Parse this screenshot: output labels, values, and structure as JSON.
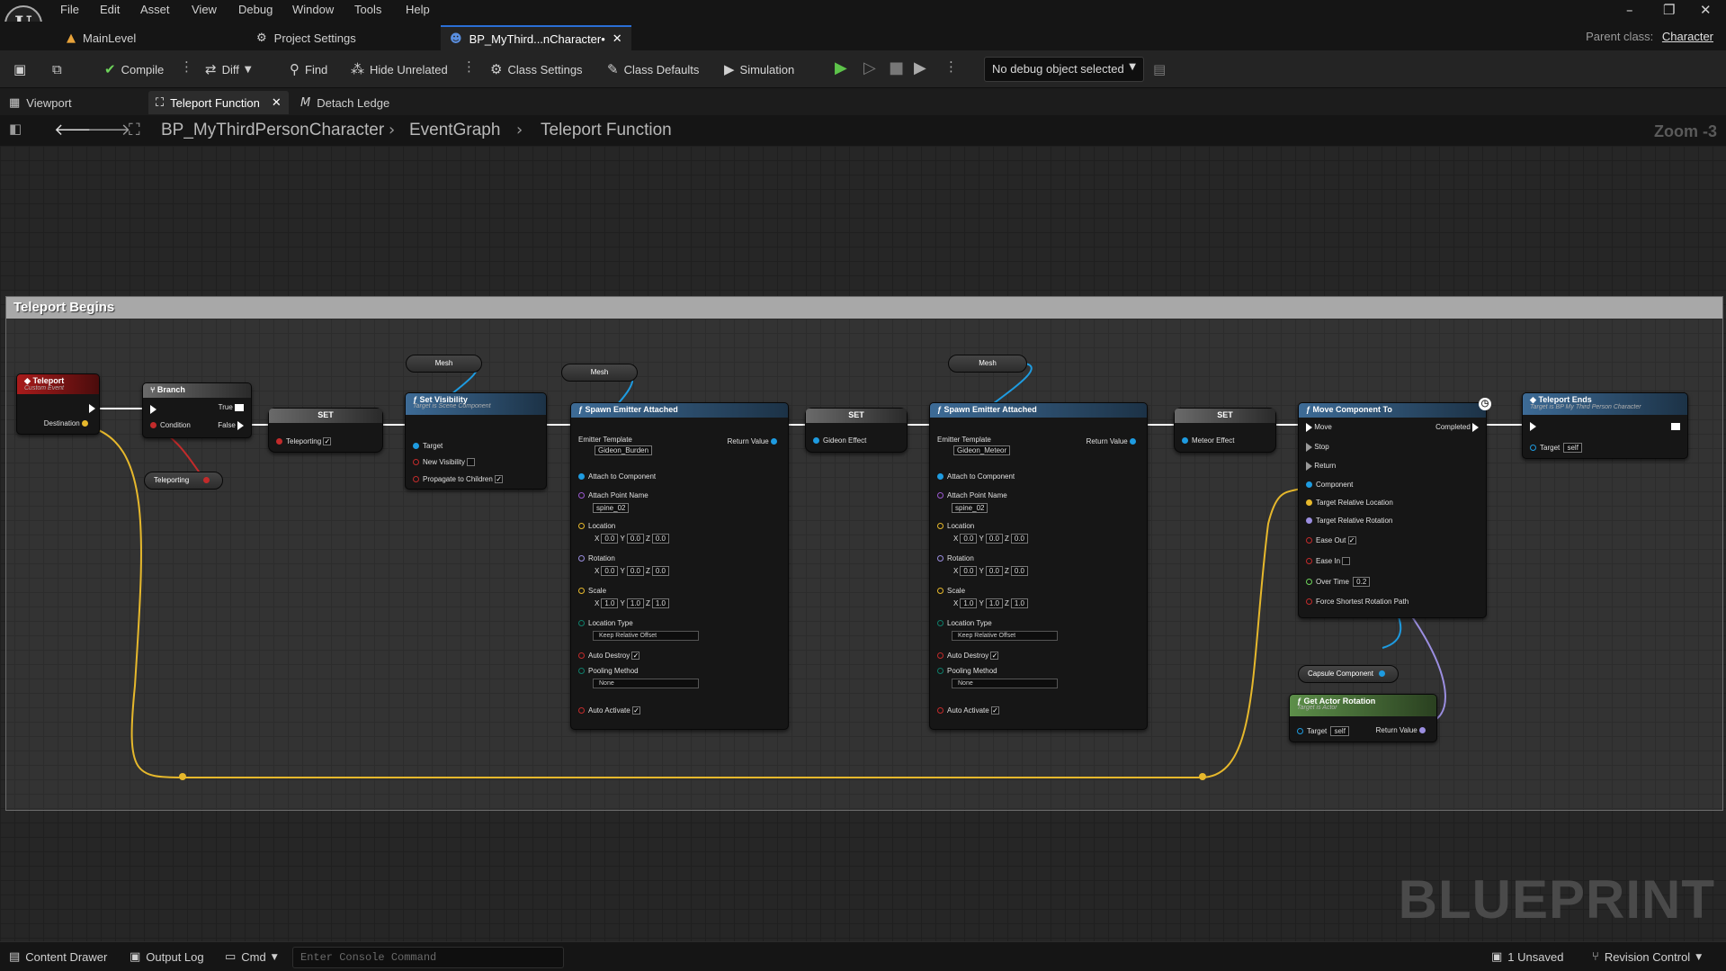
{
  "menu": [
    "File",
    "Edit",
    "Asset",
    "View",
    "Debug",
    "Window",
    "Tools",
    "Help"
  ],
  "logo": "U",
  "doc_tabs": [
    {
      "label": "MainLevel",
      "icon": "level-icon"
    },
    {
      "label": "Project Settings",
      "icon": "settings-icon"
    },
    {
      "label": "BP_MyThird...nCharacter•",
      "icon": "character-icon",
      "active": true
    }
  ],
  "parent_class": {
    "label": "Parent class:",
    "value": "Character"
  },
  "toolbar": {
    "compile": "Compile",
    "diff": "Diff",
    "find": "Find",
    "hide_unrelated": "Hide Unrelated",
    "class_settings": "Class Settings",
    "class_defaults": "Class Defaults",
    "simulation": "Simulation",
    "debug_select": "No debug object selected"
  },
  "editor_tabs": [
    {
      "label": "Viewport"
    },
    {
      "label": "Teleport Function",
      "active": true
    },
    {
      "label": "Detach Ledge"
    }
  ],
  "breadcrumb": [
    "BP_MyThirdPersonCharacter",
    "EventGraph",
    "Teleport Function"
  ],
  "zoom": "Zoom -3",
  "comment_title": "Teleport Begins",
  "watermark": "BLUEPRINT",
  "nodes": {
    "teleport_event": {
      "title": "Teleport",
      "subtitle": "Custom Event",
      "pin": "Destination"
    },
    "branch": {
      "title": "Branch",
      "condition": "Condition",
      "true": "True",
      "false": "False"
    },
    "teleporting_var": "Teleporting",
    "set1": {
      "title": "SET",
      "pin": "Teleporting"
    },
    "mesh_var": "Mesh",
    "set_visibility": {
      "title": "Set Visibility",
      "subtitle": "Target is Scene Component",
      "target": "Target",
      "new_visibility": "New Visibility",
      "propagate": "Propagate to Children"
    },
    "spawn1": {
      "title": "Spawn Emitter Attached",
      "emitter": "Emitter Template",
      "emitter_value": "Gideon_Burden",
      "return": "Return Value",
      "attach": "Attach to Component",
      "attach_point": "Attach Point Name",
      "attach_value": "spine_02",
      "location": "Location",
      "rotation": "Rotation",
      "scale": "Scale",
      "location_type": "Location Type",
      "location_type_value": "Keep Relative Offset",
      "auto_destroy": "Auto Destroy",
      "pooling": "Pooling Method",
      "pooling_value": "None",
      "auto_activate": "Auto Activate"
    },
    "set2": {
      "title": "SET",
      "pin": "Gideon Effect"
    },
    "spawn2": {
      "title": "Spawn Emitter Attached",
      "emitter": "Emitter Template",
      "emitter_value": "Gideon_Meteor",
      "return": "Return Value",
      "attach": "Attach to Component",
      "attach_point": "Attach Point Name",
      "attach_value": "spine_02",
      "location": "Location",
      "rotation": "Rotation",
      "scale": "Scale",
      "location_type": "Location Type",
      "location_type_value": "Keep Relative Offset",
      "auto_destroy": "Auto Destroy",
      "pooling": "Pooling Method",
      "pooling_value": "None",
      "auto_activate": "Auto Activate"
    },
    "set3": {
      "title": "SET",
      "pin": "Meteor Effect"
    },
    "move_component": {
      "title": "Move Component To",
      "move": "Move",
      "completed": "Completed",
      "stop": "Stop",
      "return": "Return",
      "component": "Component",
      "target_loc": "Target Relative Location",
      "target_rot": "Target Relative Rotation",
      "ease_out": "Ease Out",
      "ease_in": "Ease In",
      "over_time": "Over Time",
      "over_time_value": "0.2",
      "force": "Force Shortest Rotation Path"
    },
    "teleport_ends": {
      "title": "Teleport Ends",
      "subtitle": "Target is BP My Third Person Character",
      "target": "Target",
      "target_value": "self"
    },
    "capsule_var": "Capsule Component",
    "get_actor_rotation": {
      "title": "Get Actor Rotation",
      "subtitle": "Target is Actor",
      "target": "Target",
      "target_value": "self",
      "return": "Return Value"
    }
  },
  "vector_labels": {
    "x": "X",
    "y": "Y",
    "z": "Z",
    "zero": "0.0",
    "one": "1.0"
  },
  "statusbar": {
    "content_drawer": "Content Drawer",
    "output_log": "Output Log",
    "cmd": "Cmd",
    "console_placeholder": "Enter Console Command",
    "unsaved": "1 Unsaved",
    "revision_control": "Revision Control"
  },
  "colors": {
    "accent": "#2a6fd6",
    "exec_wire": "#ffffff",
    "vector_wire": "#e6b82c",
    "object_wire": "#1e9be0",
    "event_red": "#a91b1b"
  }
}
